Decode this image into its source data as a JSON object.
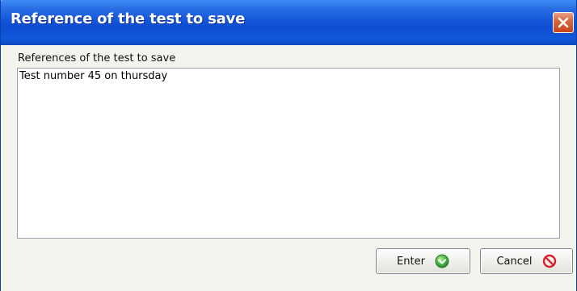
{
  "window": {
    "title": "Reference of the test to save",
    "close_icon": "close-icon"
  },
  "form": {
    "label": "References of the test to save",
    "value": "Test number 45 on thursday"
  },
  "buttons": {
    "enter_label": "Enter",
    "enter_icon": "green-arrow-down-icon",
    "cancel_label": "Cancel",
    "cancel_icon": "red-prohibited-icon"
  },
  "colors": {
    "titlebar": "#0d4dd2",
    "close_button": "#d8673f",
    "enter_icon": "#3fa93a",
    "cancel_icon": "#d8202a"
  }
}
